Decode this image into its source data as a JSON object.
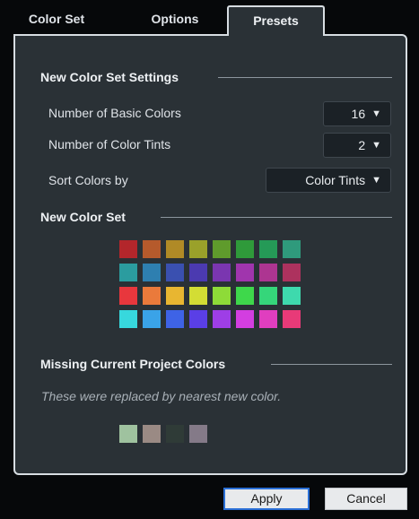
{
  "tabs": [
    {
      "label": "Color Set",
      "active": false
    },
    {
      "label": "Options",
      "active": false
    },
    {
      "label": "Presets",
      "active": true
    }
  ],
  "settings": {
    "header": "New Color Set Settings",
    "basic_colors": {
      "label": "Number of Basic Colors",
      "value": "16"
    },
    "color_tints": {
      "label": "Number of Color Tints",
      "value": "2"
    },
    "sort_by": {
      "label": "Sort Colors by",
      "value": "Color Tints"
    }
  },
  "new_set": {
    "header": "New Color Set",
    "swatches": [
      [
        "#b3262b",
        "#b55a2c",
        "#b08a26",
        "#9aa12a",
        "#5f9b2c",
        "#2f9a3a",
        "#259a57",
        "#2f9a7c"
      ],
      [
        "#2b9c9f",
        "#2e7fb0",
        "#3a50b0",
        "#4b3ab0",
        "#7a36b0",
        "#a035ad",
        "#ad3591",
        "#ad325e"
      ],
      [
        "#e8373d",
        "#ea7a3b",
        "#e8b631",
        "#d3dd34",
        "#8edb38",
        "#3ed84b",
        "#35d67a",
        "#3ed9ad"
      ],
      [
        "#37d8dd",
        "#3aa3e8",
        "#3e63e6",
        "#5a3fe6",
        "#9e3ee6",
        "#d33ee0",
        "#e03ebf",
        "#e83a78"
      ]
    ]
  },
  "missing": {
    "header": "Missing Current Project Colors",
    "note": "These were replaced by nearest new color.",
    "swatches": [
      "#9fc29f",
      "#9a8a84",
      "#2f3b37",
      "#847a88"
    ]
  },
  "buttons": {
    "apply": "Apply",
    "cancel": "Cancel"
  }
}
